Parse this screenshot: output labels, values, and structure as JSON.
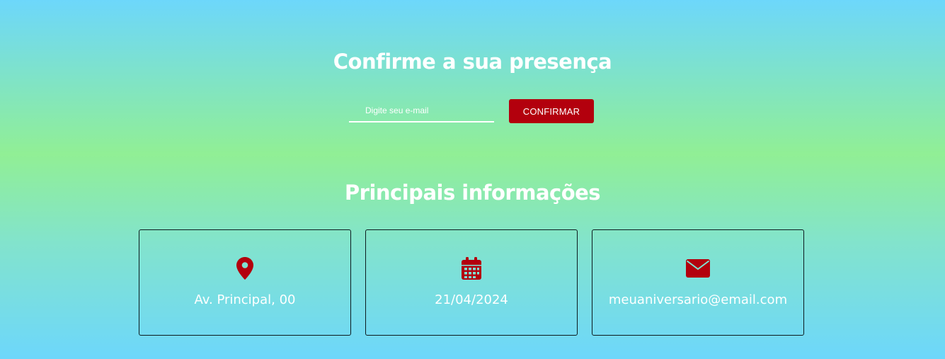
{
  "rsvp": {
    "title": "Confirme a sua presença",
    "email_placeholder": "Digite seu e-mail",
    "email_value": "",
    "confirm_label": "CONFIRMAR"
  },
  "info": {
    "title": "Principais informações",
    "cards": [
      {
        "icon": "map-pin-icon",
        "text": "Av. Principal, 00"
      },
      {
        "icon": "calendar-icon",
        "text": "21/04/2024"
      },
      {
        "icon": "envelope-icon",
        "text": "meuaniversario@email.com"
      }
    ]
  },
  "colors": {
    "accent": "#b3000d",
    "text": "#ffffff",
    "gradient_top": "#6dd7fb",
    "gradient_mid": "#91ef95",
    "card_border": "#0d1b1f"
  }
}
